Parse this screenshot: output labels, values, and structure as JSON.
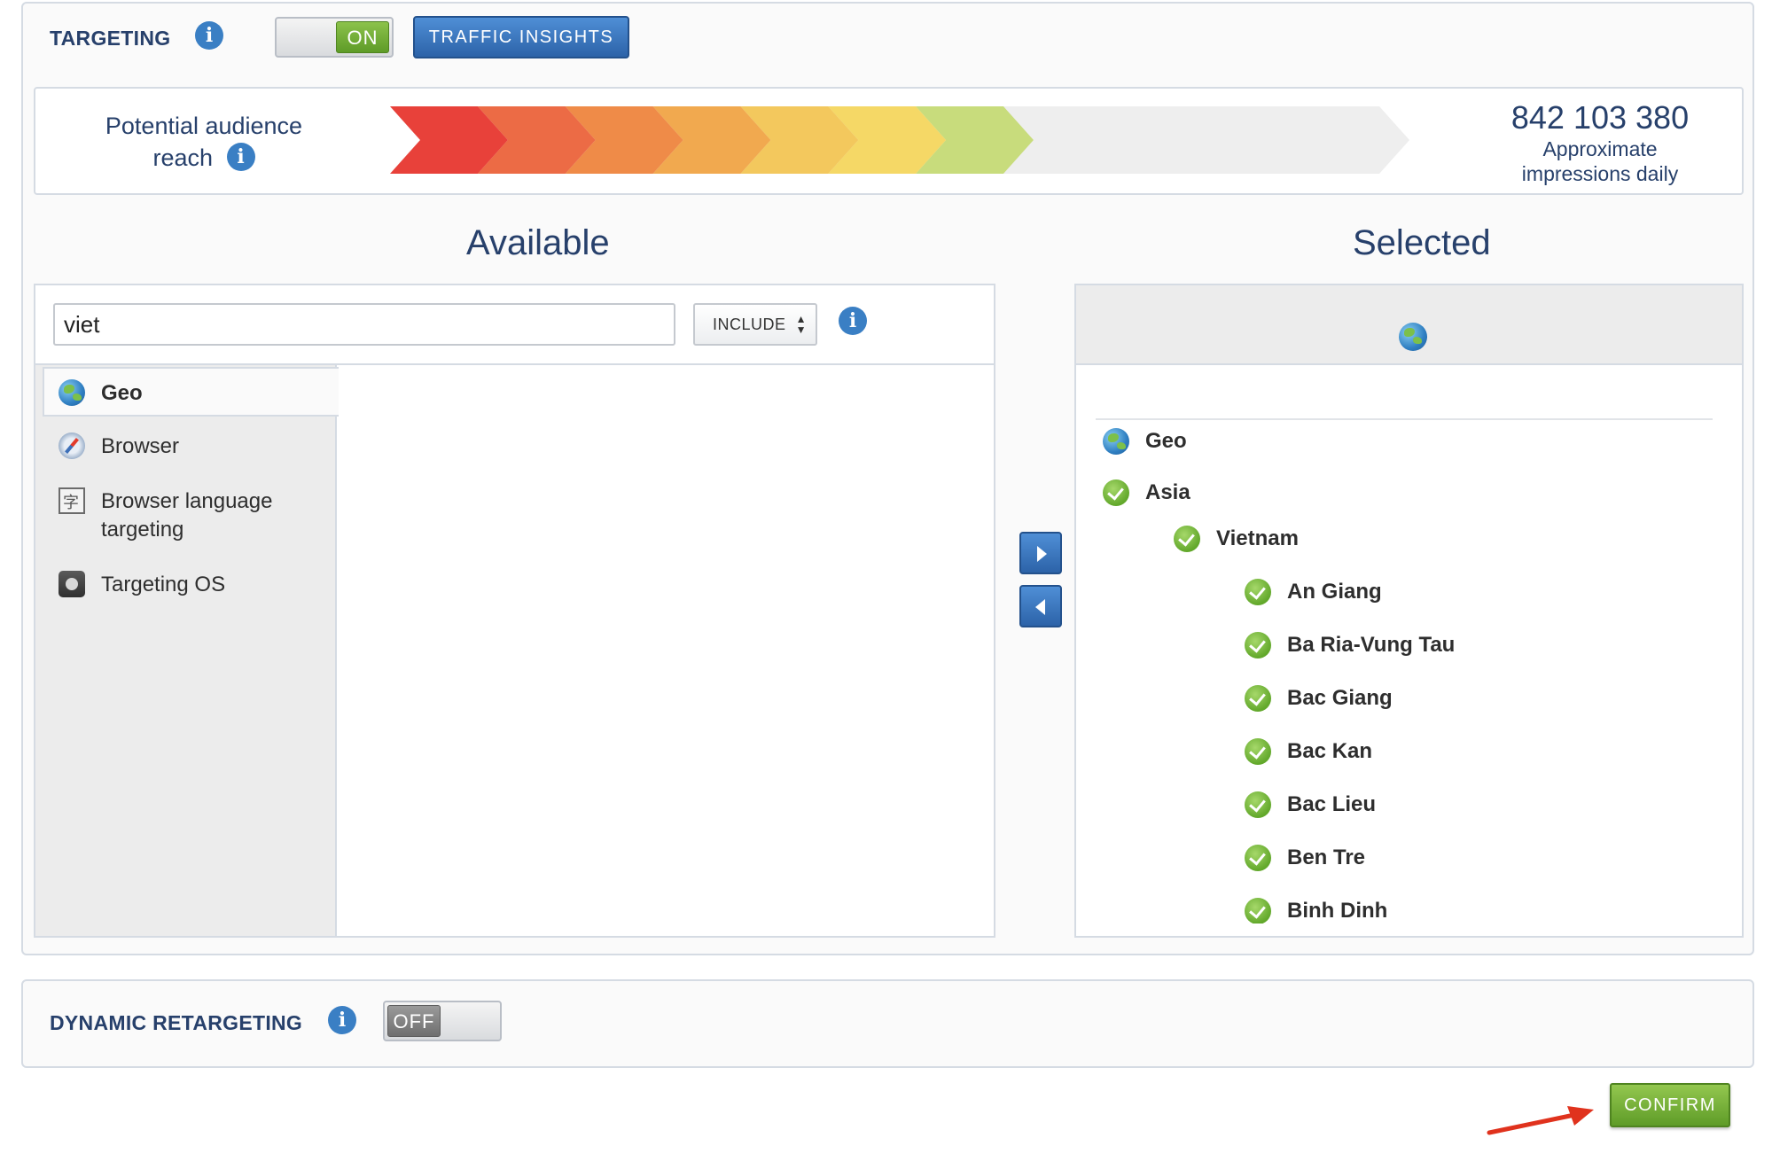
{
  "targeting": {
    "title": "TARGETING",
    "info": "i",
    "toggle_label": "ON",
    "traffic_insights_label": "TRAFFIC INSIGHTS"
  },
  "reach": {
    "label_line1": "Potential audience",
    "label_line2": "reach",
    "info": "i",
    "number": "842 103 380",
    "sub_line1": "Approximate",
    "sub_line2": "impressions daily",
    "level": 0.62,
    "colors": [
      "#e8413a",
      "#ec6b45",
      "#ef8b48",
      "#f1a94f",
      "#f3c85d",
      "#f5d866",
      "#c8dc7c",
      "#eeeeee"
    ]
  },
  "available": {
    "title": "Available",
    "search_value": "viet",
    "include_label": "INCLUDE",
    "info": "i",
    "categories": [
      {
        "label": "Geo",
        "icon": "globe-icon"
      },
      {
        "label": "Browser",
        "icon": "compass-icon"
      },
      {
        "label": "Browser language targeting",
        "icon": "language-icon"
      },
      {
        "label": "Targeting OS",
        "icon": "os-icon"
      }
    ]
  },
  "selected": {
    "title": "Selected",
    "items": [
      {
        "label": "Geo",
        "level": 0,
        "icon": "globe-icon"
      },
      {
        "label": "Asia",
        "level": 0,
        "icon": "check-icon"
      },
      {
        "label": "Vietnam",
        "level": 1,
        "icon": "check-icon"
      },
      {
        "label": "An Giang",
        "level": 2,
        "icon": "check-icon"
      },
      {
        "label": "Ba Ria-Vung Tau",
        "level": 2,
        "icon": "check-icon"
      },
      {
        "label": "Bac Giang",
        "level": 2,
        "icon": "check-icon"
      },
      {
        "label": "Bac Kan",
        "level": 2,
        "icon": "check-icon"
      },
      {
        "label": "Bac Lieu",
        "level": 2,
        "icon": "check-icon"
      },
      {
        "label": "Ben Tre",
        "level": 2,
        "icon": "check-icon"
      },
      {
        "label": "Binh Dinh",
        "level": 2,
        "icon": "check-icon"
      }
    ]
  },
  "retargeting": {
    "title": "DYNAMIC RETARGETING",
    "info": "i",
    "toggle_label": "OFF"
  },
  "confirm_label": "CONFIRM",
  "colors": {
    "brand_blue": "#2c63a8",
    "heading": "#27406b",
    "success_green": "#62a82b",
    "annotation_red": "#e0321d"
  }
}
